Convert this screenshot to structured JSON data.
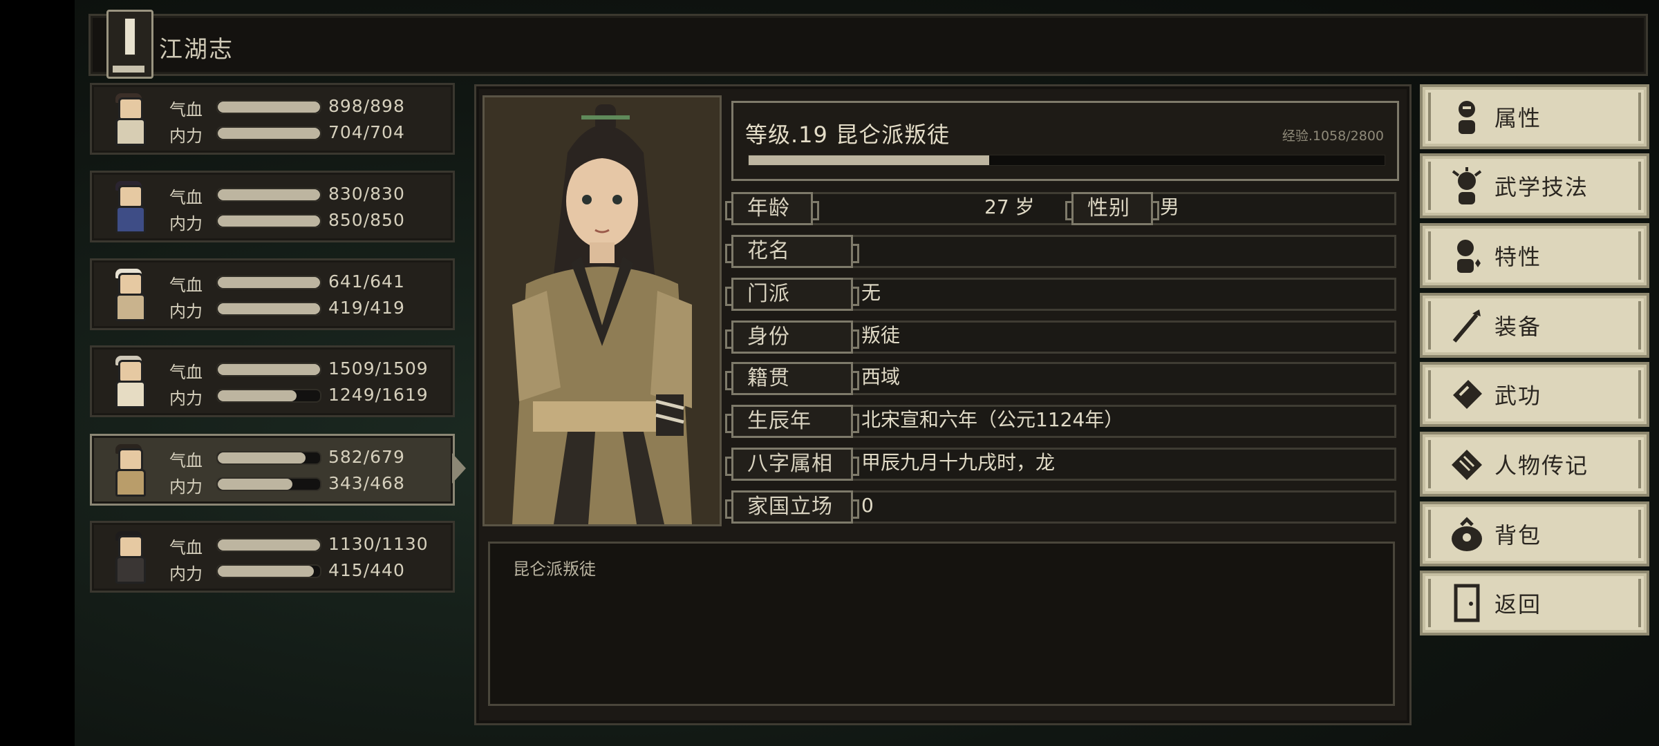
{
  "header": {
    "title": "江湖志",
    "icon": "book-icon"
  },
  "party": [
    {
      "hp_label": "气血",
      "hp": "898/898",
      "hp_ratio": 1.0,
      "mp_label": "内力",
      "mp": "704/704",
      "mp_ratio": 1.0,
      "hair": "#3b2f28",
      "cloth": "#d7cdb3",
      "selected": false
    },
    {
      "hp_label": "气血",
      "hp": "830/830",
      "hp_ratio": 1.0,
      "mp_label": "内力",
      "mp": "850/850",
      "mp_ratio": 1.0,
      "hair": "#2a2430",
      "cloth": "#3e4d86",
      "selected": false
    },
    {
      "hp_label": "气血",
      "hp": "641/641",
      "hp_ratio": 1.0,
      "mp_label": "内力",
      "mp": "419/419",
      "mp_ratio": 1.0,
      "hair": "#e8e2d3",
      "cloth": "#c9b38d",
      "selected": false
    },
    {
      "hp_label": "气血",
      "hp": "1509/1509",
      "hp_ratio": 1.0,
      "mp_label": "内力",
      "mp": "1249/1619",
      "mp_ratio": 0.77,
      "hair": "#cfc8b8",
      "cloth": "#e6dcc3",
      "selected": false
    },
    {
      "hp_label": "气血",
      "hp": "582/679",
      "hp_ratio": 0.86,
      "mp_label": "内力",
      "mp": "343/468",
      "mp_ratio": 0.73,
      "hair": "#2a241e",
      "cloth": "#b99d6a",
      "selected": true
    },
    {
      "hp_label": "气血",
      "hp": "1130/1130",
      "hp_ratio": 1.0,
      "mp_label": "内力",
      "mp": "415/440",
      "mp_ratio": 0.94,
      "hair": "#1e1c1c",
      "cloth": "#3a3634",
      "selected": false
    }
  ],
  "character": {
    "level_title": "等级.19 昆仑派叛徒",
    "exp_text": "经验.1058/2800",
    "exp_ratio": 0.378,
    "age_label": "年龄",
    "age_value": "27 岁",
    "gender_label": "性别",
    "gender_value": "男",
    "nickname_label": "花名",
    "nickname_value": "",
    "sect_label": "门派",
    "sect_value": "无",
    "identity_label": "身份",
    "identity_value": "叛徒",
    "origin_label": "籍贯",
    "origin_value": "西域",
    "birth_label": "生辰年",
    "birth_value": "北宋宣和六年（公元1124年）",
    "bazi_label": "八字属相",
    "bazi_value": "甲辰九月十九戌时，龙",
    "stance_label": "家国立场",
    "stance_value": "0",
    "description": "昆仑派叛徒"
  },
  "menu": [
    {
      "label": "属性",
      "icon": "attributes-icon"
    },
    {
      "label": "武学技法",
      "icon": "martial-skills-icon"
    },
    {
      "label": "特性",
      "icon": "traits-icon"
    },
    {
      "label": "装备",
      "icon": "equipment-icon"
    },
    {
      "label": "武功",
      "icon": "kungfu-book-icon"
    },
    {
      "label": "人物传记",
      "icon": "biography-icon"
    },
    {
      "label": "背包",
      "icon": "bag-icon"
    },
    {
      "label": "返回",
      "icon": "return-door-icon"
    }
  ],
  "colors": {
    "panel": "#1c1915",
    "frame": "#7e7a6a",
    "button": "#ddd6bb",
    "bar_fill": "#bdb5a0"
  }
}
